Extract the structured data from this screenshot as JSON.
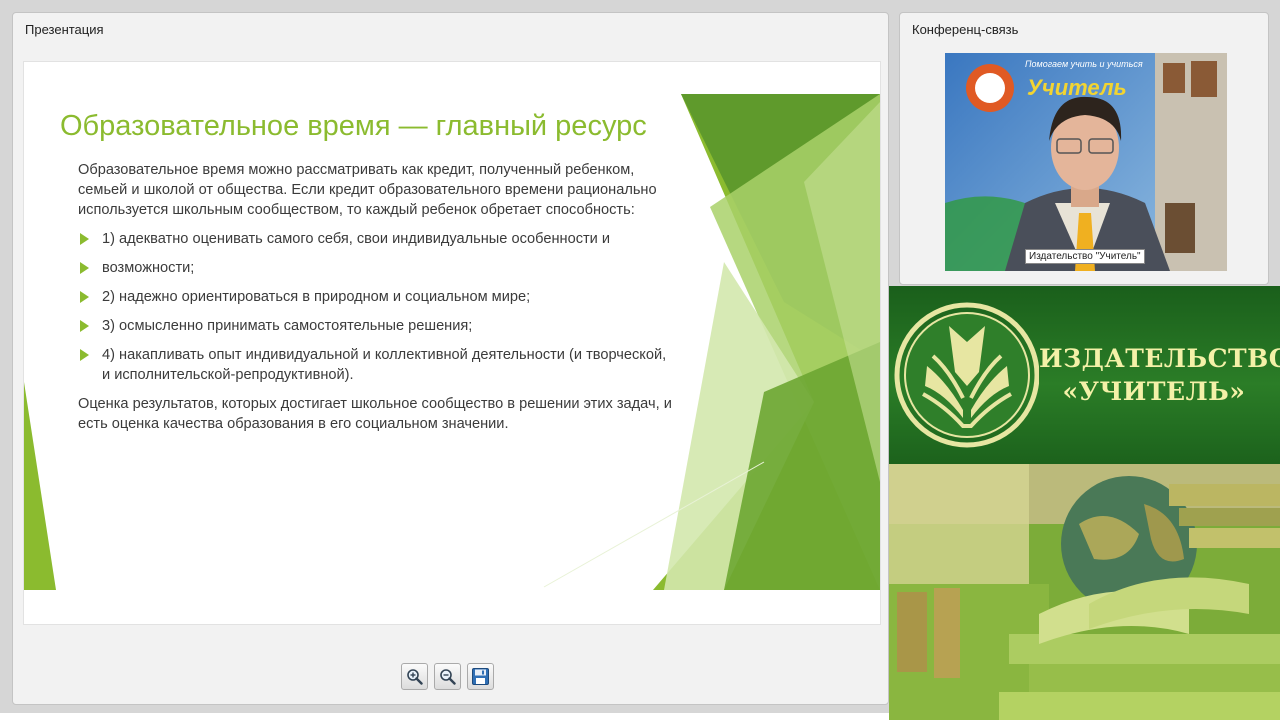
{
  "presentation": {
    "title": "Презентация",
    "slide": {
      "title": "Образовательное время — главный ресурс",
      "intro": "Образовательное время можно рассматривать как кредит, полученный ребенком, семьей и школой от общества. Если кредит образовательного времени рационально используется школьным сообществом, то каждый ребенок обретает способность:",
      "bullets": [
        "1) адекватно оценивать самого себя, свои индивидуальные особенности и",
        "возможности;",
        "2) надежно ориентироваться в природном и социальном мире;",
        "3) осмысленно принимать самостоятельные решения;",
        "4) накапливать опыт индивидуальной и коллективной деятельности (и творческой, и исполнительской-репродуктивной)."
      ],
      "conclusion": "Оценка результатов, которых достигает школьное сообщество в решении этих задач, и есть оценка качества образования в его социальном значении."
    },
    "toolbar": {
      "zoom_in": "zoom-in-icon",
      "zoom_out": "zoom-out-icon",
      "save": "save-icon"
    }
  },
  "conference": {
    "title": "Конференц-связь",
    "video_caption": "Издательство \"Учитель\"",
    "backdrop_text": {
      "top": "Помогаем учить и учиться",
      "brand": "Учитель"
    }
  },
  "publisher": {
    "name_line1": "ИЗДАТЕЛЬСТВО",
    "name_line2": "«УЧИТЕЛЬ»"
  },
  "colors": {
    "accent_green": "#8bbb2f",
    "brand_green": "#1f6a20",
    "brand_text": "#f4f1a8"
  }
}
